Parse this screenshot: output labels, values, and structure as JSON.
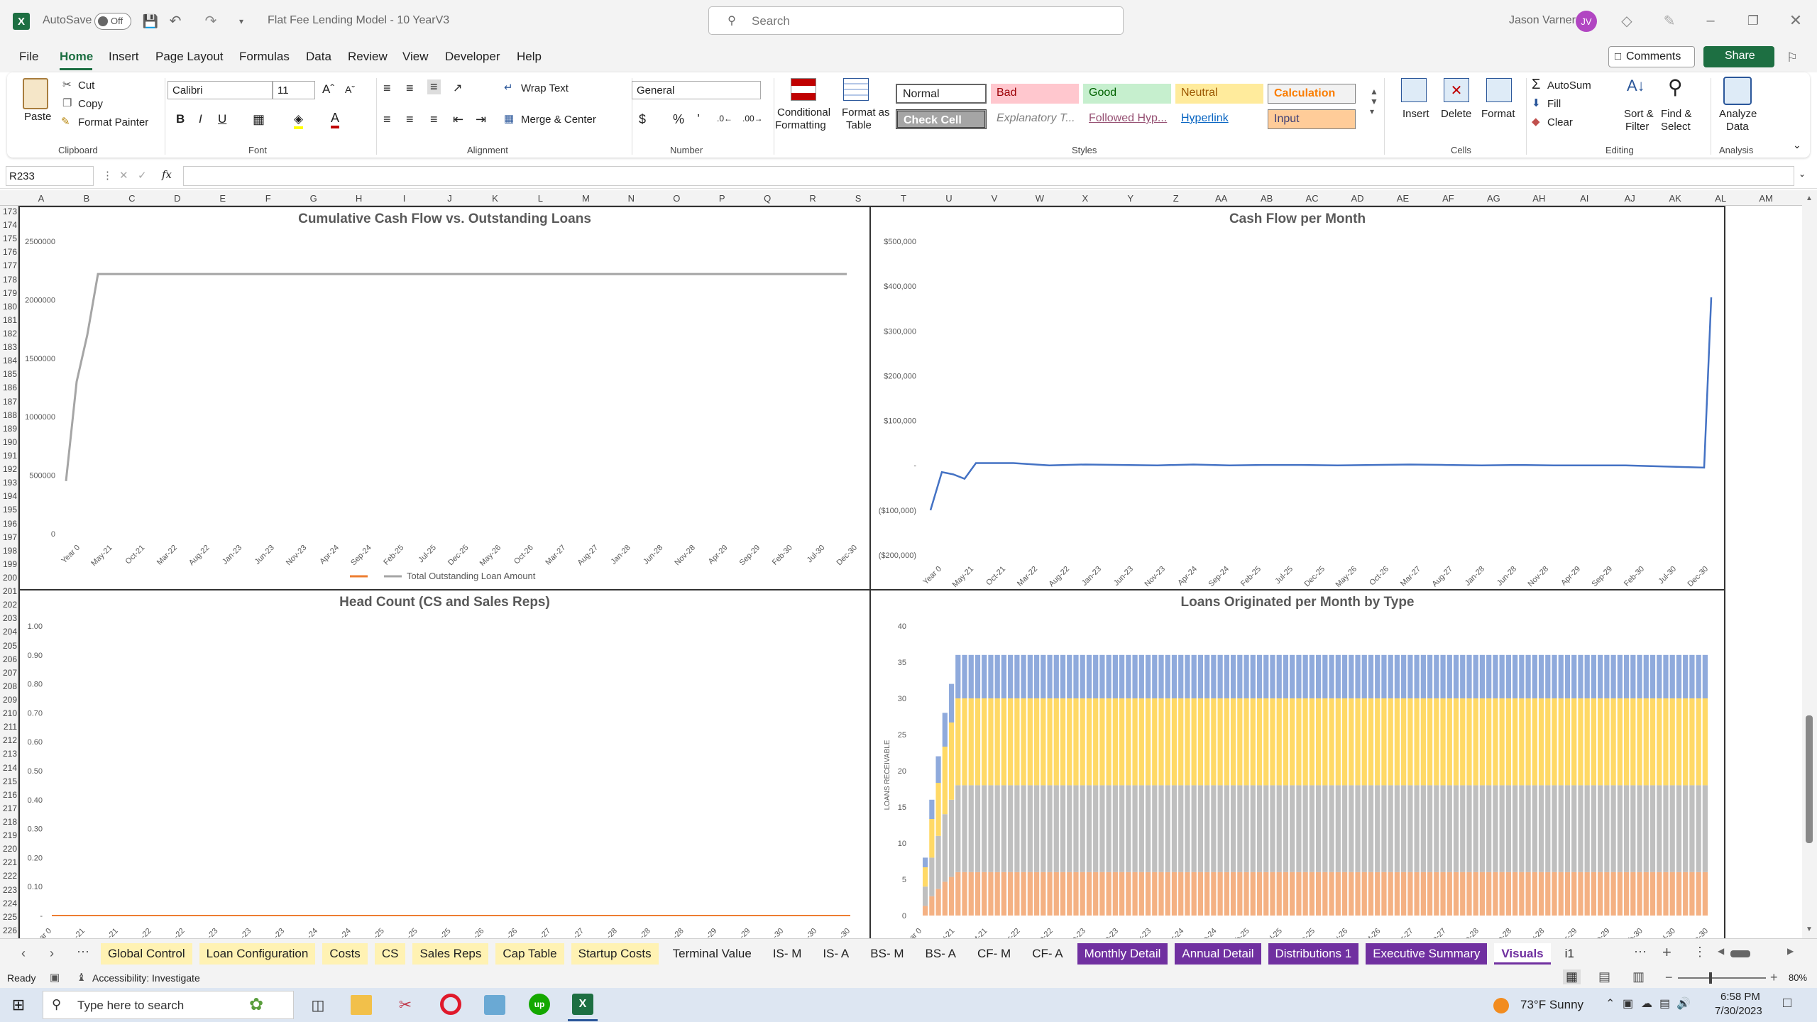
{
  "app": {
    "title": "Flat Fee Lending Model - 10 YearV3",
    "autosave_label": "AutoSave",
    "autosave_state": "Off",
    "search_placeholder": "Search",
    "user_name": "Jason Varner",
    "user_initials": "JV"
  },
  "menu": {
    "items": [
      "File",
      "Home",
      "Insert",
      "Page Layout",
      "Formulas",
      "Data",
      "Review",
      "View",
      "Developer",
      "Help"
    ],
    "active": "Home",
    "comments": "Comments",
    "share": "Share"
  },
  "ribbon": {
    "clipboard": {
      "paste": "Paste",
      "cut": "Cut",
      "copy": "Copy",
      "format_painter": "Format Painter",
      "group": "Clipboard"
    },
    "font": {
      "name": "Calibri",
      "size": "11",
      "group": "Font"
    },
    "alignment": {
      "wrap": "Wrap Text",
      "merge": "Merge & Center",
      "group": "Alignment"
    },
    "number": {
      "format": "General",
      "group": "Number"
    },
    "styles": {
      "conditional": "Conditional",
      "conditional2": "Formatting",
      "format_table": "Format as",
      "format_table2": "Table",
      "group": "Styles",
      "cells": [
        "Normal",
        "Bad",
        "Good",
        "Neutral",
        "Calculation",
        "Check Cell",
        "Explanatory T...",
        "Followed Hyp...",
        "Hyperlink",
        "Input"
      ]
    },
    "cells": {
      "insert": "Insert",
      "delete": "Delete",
      "format": "Format",
      "group": "Cells"
    },
    "editing": {
      "autosum": "AutoSum",
      "fill": "Fill",
      "clear": "Clear",
      "sort": "Sort &",
      "sort2": "Filter",
      "find": "Find &",
      "find2": "Select",
      "group": "Editing"
    },
    "analysis": {
      "analyze": "Analyze",
      "analyze2": "Data",
      "group": "Analysis"
    }
  },
  "formula_bar": {
    "name_box": "R233",
    "fx": "fx",
    "value": ""
  },
  "columns": [
    "A",
    "B",
    "C",
    "D",
    "E",
    "F",
    "G",
    "H",
    "I",
    "J",
    "K",
    "L",
    "M",
    "N",
    "O",
    "P",
    "Q",
    "R",
    "S",
    "T",
    "U",
    "V",
    "W",
    "X",
    "Y",
    "Z",
    "AA",
    "AB",
    "AC",
    "AD",
    "AE",
    "AF",
    "AG",
    "AH",
    "AI",
    "AJ",
    "AK",
    "AL",
    "AM"
  ],
  "rows_start": 173,
  "rows_end": 226,
  "x_ticks_left": [
    "Year 0",
    "May-21",
    "Oct-21",
    "Mar-22",
    "Aug-22",
    "Jan-23",
    "Jun-23",
    "Nov-23",
    "Apr-24",
    "Sep-24",
    "Feb-25",
    "Jul-25",
    "Dec-25",
    "May-26",
    "Oct-26",
    "Mar-27",
    "Aug-27",
    "Jan-28",
    "Jun-28",
    "Nov-28",
    "Apr-29",
    "Sep-29",
    "Feb-30",
    "Jul-30",
    "Dec-30"
  ],
  "x_ticks_right": [
    "Year 0",
    "May-21",
    "Oct-21",
    "Mar-22",
    "Aug-22",
    "Jan-23",
    "Jun-23",
    "Nov-23",
    "Apr-24",
    "Sep-24",
    "Feb-25",
    "Jul-25",
    "Dec-25",
    "May-26",
    "Oct-26",
    "Mar-27",
    "Aug-27",
    "Jan-28",
    "Jun-28",
    "Nov-28",
    "Apr-29",
    "Sep-29",
    "Feb-30",
    "Jul-30",
    "Dec-30"
  ],
  "chart_data": [
    {
      "type": "line",
      "title": "Cumulative Cash Flow vs. Outstanding Loans",
      "ylim": [
        0,
        2500000
      ],
      "yticks": [
        "2500000",
        "2000000",
        "1500000",
        "1000000",
        "500000",
        "0"
      ],
      "legend": [
        "",
        "Total Outstanding Loan Amount"
      ],
      "legend_colors": [
        "#ed7d31",
        "#a5a5a5"
      ],
      "series": [
        {
          "name": "Total Outstanding Loan Amount",
          "color": "#a5a5a5",
          "values": [
            450000,
            1300000,
            1700000,
            2220000,
            2220000,
            2220000,
            2220000,
            2220000,
            2220000,
            2220000,
            2220000,
            2220000,
            2220000,
            2220000,
            2220000,
            2220000,
            2220000,
            2220000,
            2220000,
            2220000,
            2220000,
            2220000,
            2220000,
            2220000,
            2220000
          ]
        }
      ]
    },
    {
      "type": "line",
      "title": "Cash Flow per Month",
      "ylim": [
        -200000,
        500000
      ],
      "yticks": [
        "$500,000",
        "$400,000",
        "$300,000",
        "$200,000",
        "$100,000",
        "-",
        "($100,000)",
        "($200,000)"
      ],
      "series": [
        {
          "name": "Cash Flow",
          "color": "#4472c4",
          "values": [
            -100000,
            -15000,
            -20000,
            -30000,
            5000,
            5000,
            0,
            2000,
            1000,
            0,
            2000,
            0,
            1000,
            1000,
            0,
            1000,
            2000,
            1000,
            0,
            1000,
            0,
            0,
            0,
            -5000,
            375000
          ]
        }
      ]
    },
    {
      "type": "line",
      "title": "Head Count (CS and Sales Reps)",
      "ylim": [
        0,
        1
      ],
      "yticks": [
        "1.00",
        "0.90",
        "0.80",
        "0.70",
        "0.60",
        "0.50",
        "0.40",
        "0.30",
        "0.20",
        "0.10",
        "-"
      ],
      "series": [
        {
          "name": "",
          "color": "#ed7d31",
          "values": [
            0,
            0
          ]
        }
      ]
    },
    {
      "type": "bar",
      "title": "Loans Originated per Month by Type",
      "ylabel": "LOANS RECEIVABLE",
      "ylim": [
        0,
        40
      ],
      "yticks": [
        "40",
        "35",
        "30",
        "25",
        "20",
        "15",
        "10",
        "5",
        "0"
      ],
      "series": [
        {
          "name": "",
          "color": "#f4b183",
          "values": [
            6
          ]
        },
        {
          "name": "",
          "color": "#bfbfbf",
          "values": [
            12
          ]
        },
        {
          "name": "",
          "color": "#ffd966",
          "values": [
            12
          ]
        },
        {
          "name": "",
          "color": "#8faadc",
          "values": [
            6
          ]
        }
      ],
      "ramp_totals": [
        8,
        16,
        22,
        28,
        32,
        36
      ]
    }
  ],
  "sheet_tabs": [
    {
      "label": "Global Control",
      "style": "y"
    },
    {
      "label": "Loan Configuration",
      "style": "y"
    },
    {
      "label": "Costs",
      "style": "y"
    },
    {
      "label": "CS",
      "style": "y"
    },
    {
      "label": "Sales Reps",
      "style": "y"
    },
    {
      "label": "Cap Table",
      "style": "y"
    },
    {
      "label": "Startup Costs",
      "style": "y"
    },
    {
      "label": "Terminal Value",
      "style": "n"
    },
    {
      "label": "IS- M",
      "style": "n"
    },
    {
      "label": "IS- A",
      "style": "n"
    },
    {
      "label": "BS- M",
      "style": "n"
    },
    {
      "label": "BS- A",
      "style": "n"
    },
    {
      "label": "CF- M",
      "style": "n"
    },
    {
      "label": "CF- A",
      "style": "n"
    },
    {
      "label": "Monthly Detail",
      "style": "p"
    },
    {
      "label": "Annual Detail",
      "style": "p"
    },
    {
      "label": "Distributions 1",
      "style": "p"
    },
    {
      "label": "Executive Summary",
      "style": "p"
    },
    {
      "label": "Visuals",
      "style": "act"
    },
    {
      "label": "i1",
      "style": "n"
    }
  ],
  "status": {
    "ready": "Ready",
    "accessibility": "Accessibility: Investigate",
    "zoom": "80%"
  },
  "taskbar": {
    "search": "Type here to search",
    "weather": "73°F  Sunny",
    "time": "6:58 PM",
    "date": "7/30/2023"
  }
}
